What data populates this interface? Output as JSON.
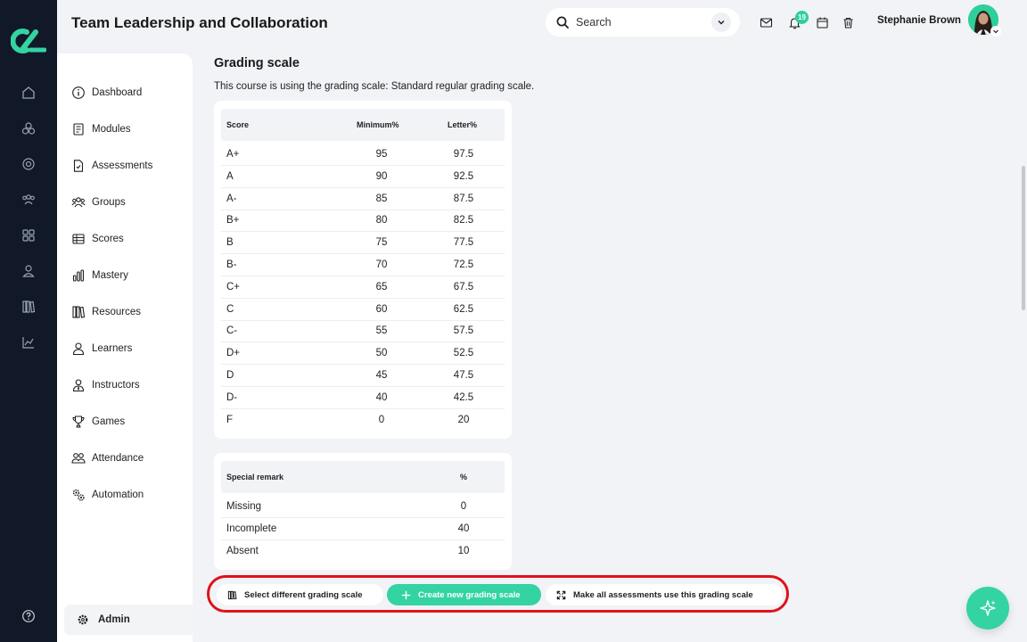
{
  "header": {
    "title": "Team Leadership and Collaboration",
    "search_label": "Search",
    "notification_count": "19",
    "user_name": "Stephanie Brown"
  },
  "sidebar": {
    "items": [
      {
        "label": "Dashboard",
        "icon": "info-icon"
      },
      {
        "label": "Modules",
        "icon": "document-icon"
      },
      {
        "label": "Assessments",
        "icon": "assessment-icon"
      },
      {
        "label": "Groups",
        "icon": "groups-icon"
      },
      {
        "label": "Scores",
        "icon": "table-icon"
      },
      {
        "label": "Mastery",
        "icon": "bar-chart-icon"
      },
      {
        "label": "Resources",
        "icon": "books-icon"
      },
      {
        "label": "Learners",
        "icon": "user-icon"
      },
      {
        "label": "Instructors",
        "icon": "instructor-icon"
      },
      {
        "label": "Games",
        "icon": "trophy-icon"
      },
      {
        "label": "Attendance",
        "icon": "attendance-icon"
      },
      {
        "label": "Automation",
        "icon": "gears-icon"
      }
    ],
    "admin_label": "Admin"
  },
  "main": {
    "title": "Grading scale",
    "description": "This course is using the grading scale: Standard regular grading scale.",
    "grade_table": {
      "headers": {
        "score": "Score",
        "minimum": "Minimum%",
        "letter": "Letter%"
      },
      "rows": [
        {
          "score": "A+",
          "minimum": "95",
          "letter": "97.5"
        },
        {
          "score": "A",
          "minimum": "90",
          "letter": "92.5"
        },
        {
          "score": "A-",
          "minimum": "85",
          "letter": "87.5"
        },
        {
          "score": "B+",
          "minimum": "80",
          "letter": "82.5"
        },
        {
          "score": "B",
          "minimum": "75",
          "letter": "77.5"
        },
        {
          "score": "B-",
          "minimum": "70",
          "letter": "72.5"
        },
        {
          "score": "C+",
          "minimum": "65",
          "letter": "67.5"
        },
        {
          "score": "C",
          "minimum": "60",
          "letter": "62.5"
        },
        {
          "score": "C-",
          "minimum": "55",
          "letter": "57.5"
        },
        {
          "score": "D+",
          "minimum": "50",
          "letter": "52.5"
        },
        {
          "score": "D",
          "minimum": "45",
          "letter": "47.5"
        },
        {
          "score": "D-",
          "minimum": "40",
          "letter": "42.5"
        },
        {
          "score": "F",
          "minimum": "0",
          "letter": "20"
        }
      ]
    },
    "remark_table": {
      "headers": {
        "remark": "Special remark",
        "percent": "%"
      },
      "rows": [
        {
          "remark": "Missing",
          "percent": "0"
        },
        {
          "remark": "Incomplete",
          "percent": "40"
        },
        {
          "remark": "Absent",
          "percent": "10"
        }
      ]
    },
    "actions": {
      "select_label": "Select different grading scale",
      "create_label": "Create new grading scale",
      "apply_all_label": "Make all assessments use this grading scale"
    }
  },
  "colors": {
    "accent": "#34d3a3",
    "rail": "#111827",
    "highlight": "#e0121b"
  }
}
